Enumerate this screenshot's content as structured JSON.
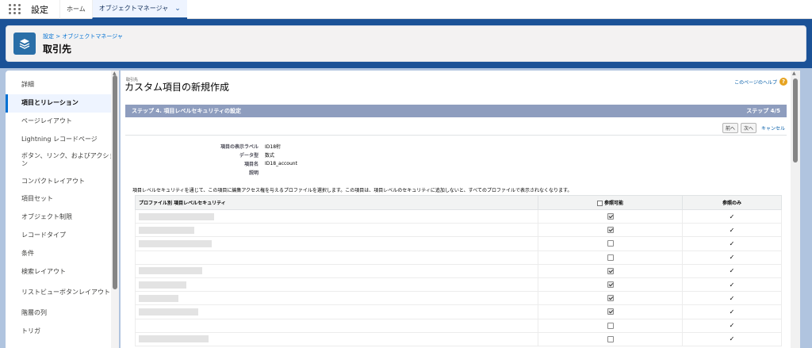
{
  "topbar": {
    "app_name": "設定",
    "tabs": [
      {
        "label": "ホーム"
      },
      {
        "label": "オブジェクトマネージャ"
      }
    ]
  },
  "header": {
    "breadcrumb": "設定 > オブジェクトマネージャ",
    "title": "取引先"
  },
  "sidebar": {
    "items": [
      {
        "label": "詳細"
      },
      {
        "label": "項目とリレーション"
      },
      {
        "label": "ページレイアウト"
      },
      {
        "label": "Lightning レコードページ"
      },
      {
        "label": "ボタン、リンク、およびアクション"
      },
      {
        "label": "コンパクトレイアウト"
      },
      {
        "label": "項目セット"
      },
      {
        "label": "オブジェクト制限"
      },
      {
        "label": "レコードタイプ"
      },
      {
        "label": "条件"
      },
      {
        "label": "検索レイアウト"
      },
      {
        "label": "リストビューボタンレイアウト"
      },
      {
        "label": "階層の列"
      },
      {
        "label": "トリガ"
      }
    ]
  },
  "main": {
    "object_label": "取引先",
    "title": "カスタム項目の新規作成",
    "help_link": "このページのヘルプ",
    "step_title": "ステップ 4. 項目レベルセキュリティの設定",
    "step_count": "ステップ 4/5",
    "buttons": {
      "prev": "前へ",
      "next": "次へ",
      "cancel": "キャンセル"
    },
    "fields": [
      {
        "label": "項目の表示ラベル",
        "value": "ID18桁"
      },
      {
        "label": "データ型",
        "value": "数式"
      },
      {
        "label": "項目名",
        "value": "ID18_account"
      },
      {
        "label": "説明",
        "value": ""
      }
    ],
    "note": "項目レベルセキュリティを通じて、この項目に編集アクセス権を与えるプロファイルを選択します。この項目は、項目レベルのセキュリティに追加しないと、すべてのプロファイルで表示されなくなります。",
    "table": {
      "headers": {
        "profile": "プロファイル別 項目レベルセキュリティ",
        "visible": "参照可能",
        "readonly": "参照のみ"
      },
      "rows": [
        {
          "visible": true,
          "readonly": true
        },
        {
          "visible": true,
          "readonly": true
        },
        {
          "visible": false,
          "readonly": true
        },
        {
          "visible": false,
          "readonly": true
        },
        {
          "visible": true,
          "readonly": true
        },
        {
          "visible": true,
          "readonly": true
        },
        {
          "visible": true,
          "readonly": true
        },
        {
          "visible": true,
          "readonly": true
        },
        {
          "visible": false,
          "readonly": true
        },
        {
          "visible": false,
          "readonly": true
        }
      ],
      "readonly_glyph": "✓"
    }
  }
}
